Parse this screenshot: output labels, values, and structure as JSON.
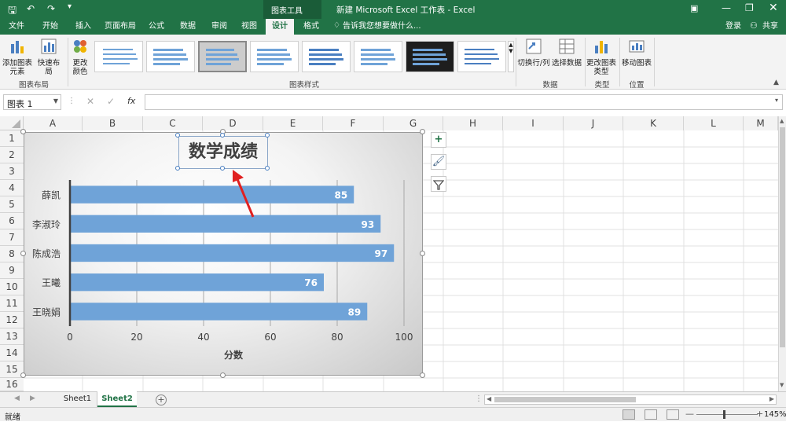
{
  "window": {
    "title": "新建 Microsoft Excel 工作表 - Excel",
    "context_tab": "图表工具"
  },
  "tabs": [
    {
      "label": "文件"
    },
    {
      "label": "开始"
    },
    {
      "label": "插入"
    },
    {
      "label": "页面布局"
    },
    {
      "label": "公式"
    },
    {
      "label": "数据"
    },
    {
      "label": "审阅"
    },
    {
      "label": "视图"
    },
    {
      "label": "设计"
    },
    {
      "label": "格式"
    }
  ],
  "tell_me": "告诉我您想要做什么...",
  "login": "登录",
  "share": "共享",
  "ribbon": {
    "add_element": "添加图表元素",
    "quick_layout": "快速布局",
    "change_colors": "更改颜色",
    "group_layout": "图表布局",
    "group_styles": "图表样式",
    "switch_rowcol": "切换行/列",
    "select_data": "选择数据",
    "group_data": "数据",
    "change_type": "更改图表类型",
    "group_type": "类型",
    "move_chart": "移动图表",
    "group_location": "位置"
  },
  "formula_bar": {
    "name_box": "图表 1",
    "fx": "fx",
    "value": ""
  },
  "columns": [
    "A",
    "B",
    "C",
    "D",
    "E",
    "F",
    "G",
    "H",
    "I",
    "J",
    "K",
    "L",
    "M"
  ],
  "rows": [
    "1",
    "2",
    "3",
    "4",
    "5",
    "6",
    "7",
    "8",
    "9",
    "10",
    "11",
    "12",
    "13",
    "14",
    "15",
    "16"
  ],
  "chart_data": {
    "type": "bar",
    "orientation": "horizontal",
    "title": "数学成绩",
    "categories": [
      "薛凯",
      "李淑玲",
      "陈成浩",
      "王曦",
      "王晓娟"
    ],
    "values": [
      85,
      93,
      97,
      76,
      89
    ],
    "xlabel": "分数",
    "ylabel": "",
    "xlim": [
      0,
      100
    ],
    "ticks": [
      "0",
      "20",
      "40",
      "60",
      "80",
      "100"
    ],
    "grid": true,
    "bar_color": "#6fa3d8"
  },
  "sheets": [
    {
      "label": "Sheet1",
      "active": false
    },
    {
      "label": "Sheet2",
      "active": true
    }
  ],
  "status": {
    "ready": "就绪",
    "zoom": "145%"
  },
  "colors": {
    "excel_green": "#217346",
    "accent_arrow": "#e02020"
  }
}
